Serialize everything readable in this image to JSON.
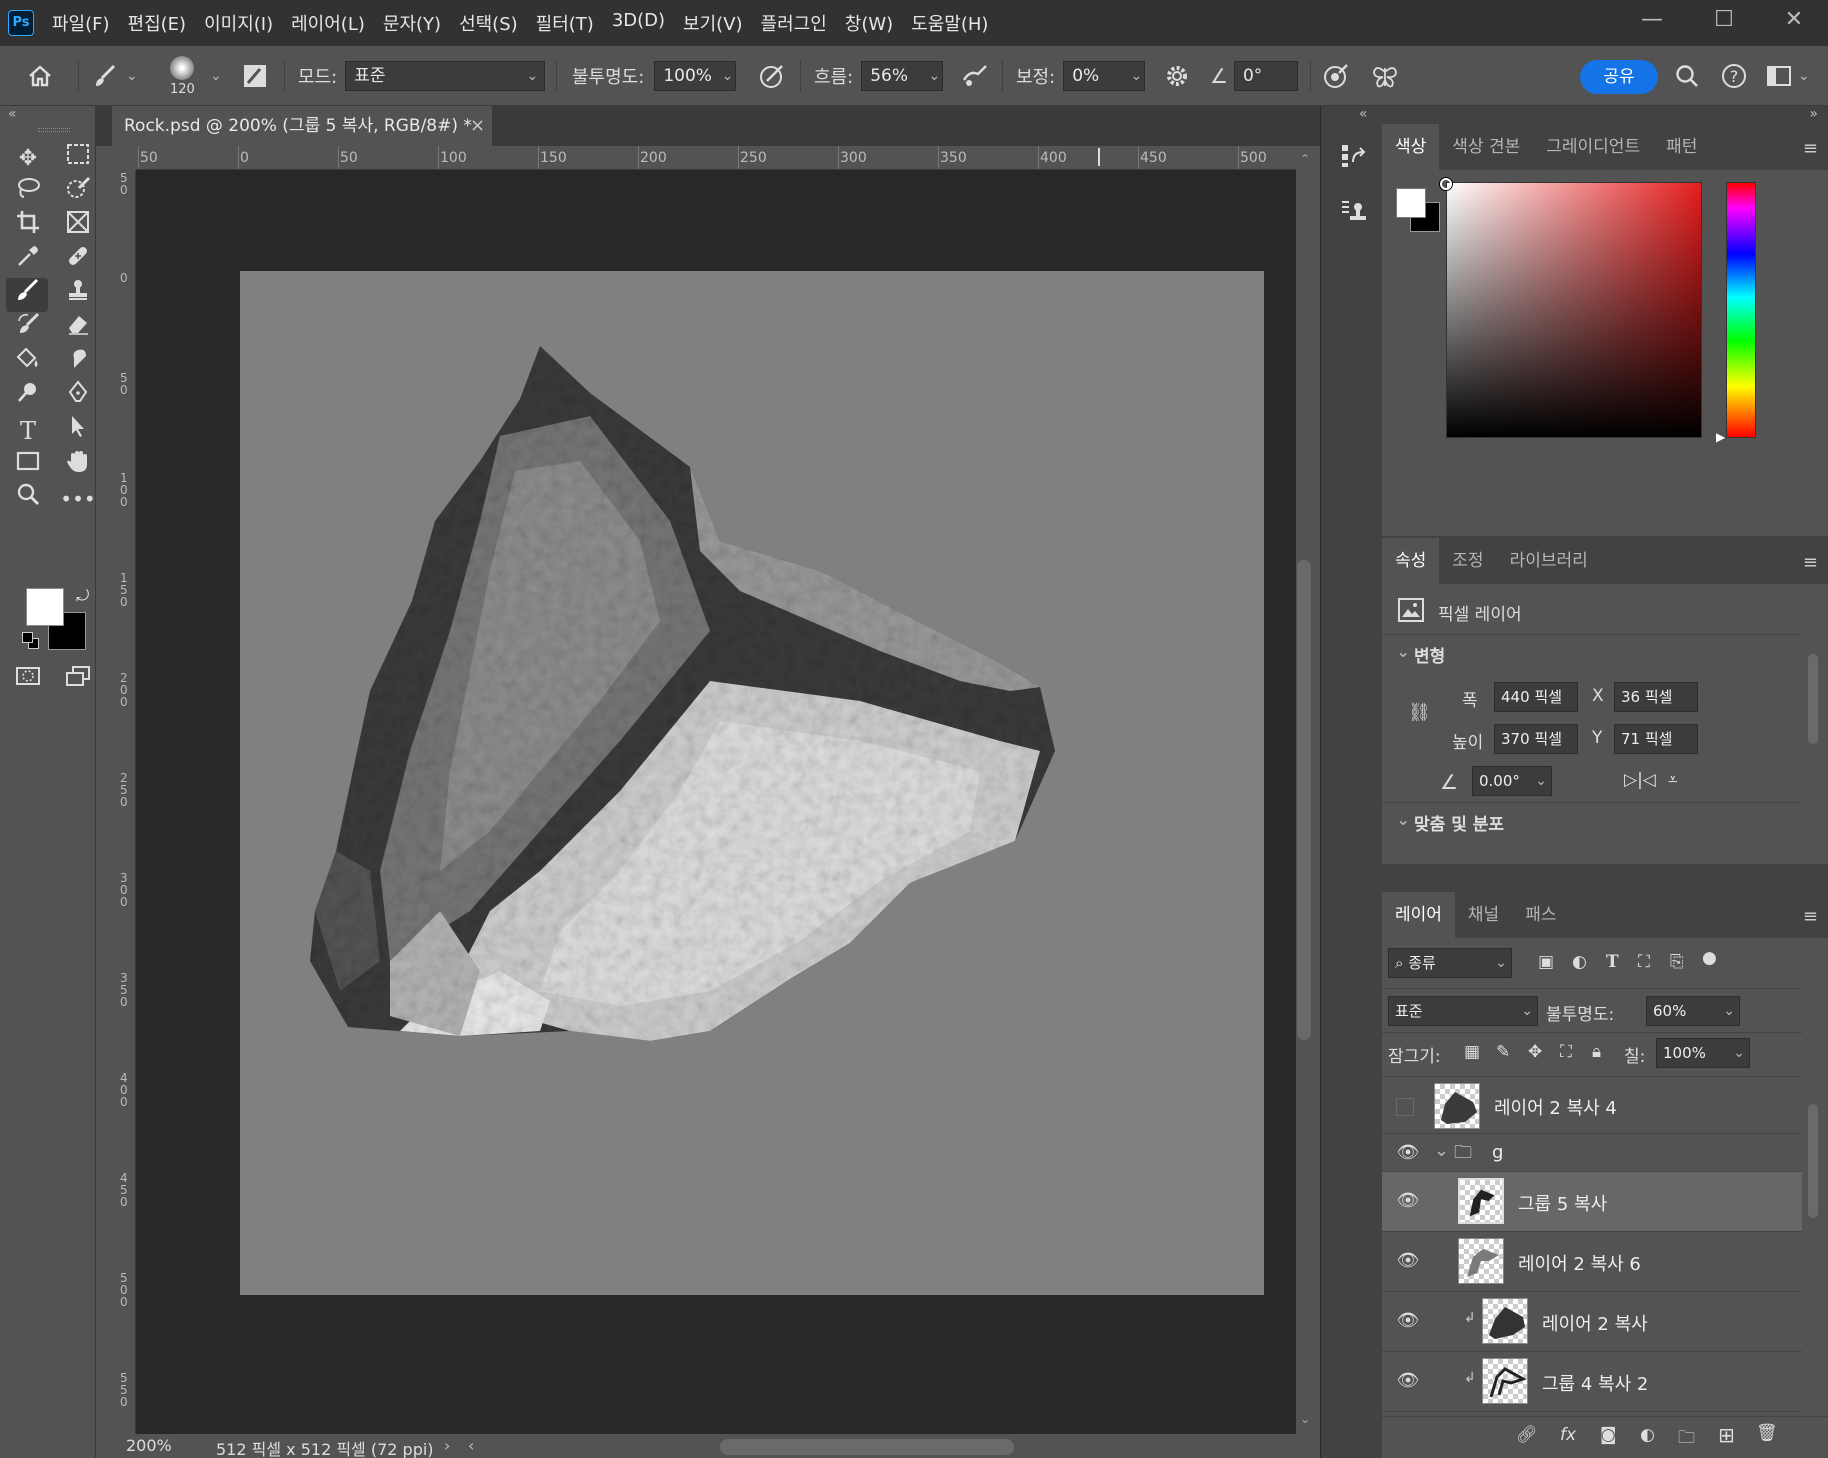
{
  "app": {
    "logo": "Ps",
    "menus": [
      "파일(F)",
      "편집(E)",
      "이미지(I)",
      "레이어(L)",
      "문자(Y)",
      "선택(S)",
      "필터(T)",
      "3D(D)",
      "보기(V)",
      "플러그인",
      "창(W)",
      "도움말(H)"
    ]
  },
  "options": {
    "brush_size": "120",
    "mode_label": "모드:",
    "mode_value": "표준",
    "opacity_label": "불투명도:",
    "opacity_value": "100%",
    "flow_label": "흐름:",
    "flow_value": "56%",
    "smoothing_label": "보정:",
    "smoothing_value": "0%",
    "angle_value": "0°",
    "share_label": "공유"
  },
  "document": {
    "tab_title": "Rock.psd @ 200% (그룹 5 복사, RGB/8#) *",
    "zoom": "200%",
    "doc_info": "512 픽셀 x 512 픽셀 (72 ppi)",
    "ruler_h_labels": [
      "50",
      "0",
      "50",
      "100",
      "150",
      "200",
      "250",
      "300",
      "350",
      "400",
      "450",
      "500"
    ],
    "ruler_v_labels": [
      "50",
      "0",
      "50",
      "100",
      "150",
      "200",
      "250",
      "300",
      "350",
      "400",
      "450",
      "500",
      "550"
    ]
  },
  "color_panel": {
    "tabs": [
      "색상",
      "색상 견본",
      "그레이디언트",
      "패턴"
    ],
    "hue_color": "#e61d1d"
  },
  "properties_panel": {
    "tabs": [
      "속성",
      "조정",
      "라이브러리"
    ],
    "layer_type": "픽셀 레이어",
    "transform_header": "변형",
    "width_label": "폭",
    "width_value": "440 픽셀",
    "height_label": "높이",
    "height_value": "370 픽셀",
    "x_label": "X",
    "x_value": "36 픽셀",
    "y_label": "Y",
    "y_value": "71 픽셀",
    "angle_value": "0.00°",
    "align_header": "맞춤 및 분포"
  },
  "layers_panel": {
    "tabs": [
      "레이어",
      "채널",
      "패스"
    ],
    "filter_kind": "종류",
    "blend_mode": "표준",
    "opacity_label": "불투명도:",
    "opacity_value": "60%",
    "lock_label": "잠그기:",
    "fill_label": "칠:",
    "fill_value": "100%",
    "layers": [
      {
        "name": "레이어 2 복사 4",
        "visible": false
      },
      {
        "name": "g",
        "visible": true,
        "group": true
      },
      {
        "name": "그룹 5 복사",
        "visible": true,
        "selected": true
      },
      {
        "name": "레이어 2 복사 6",
        "visible": true
      },
      {
        "name": "레이어 2 복사",
        "visible": true,
        "clipped": true
      },
      {
        "name": "그룹 4 복사 2",
        "visible": true,
        "clipped": true
      }
    ]
  }
}
